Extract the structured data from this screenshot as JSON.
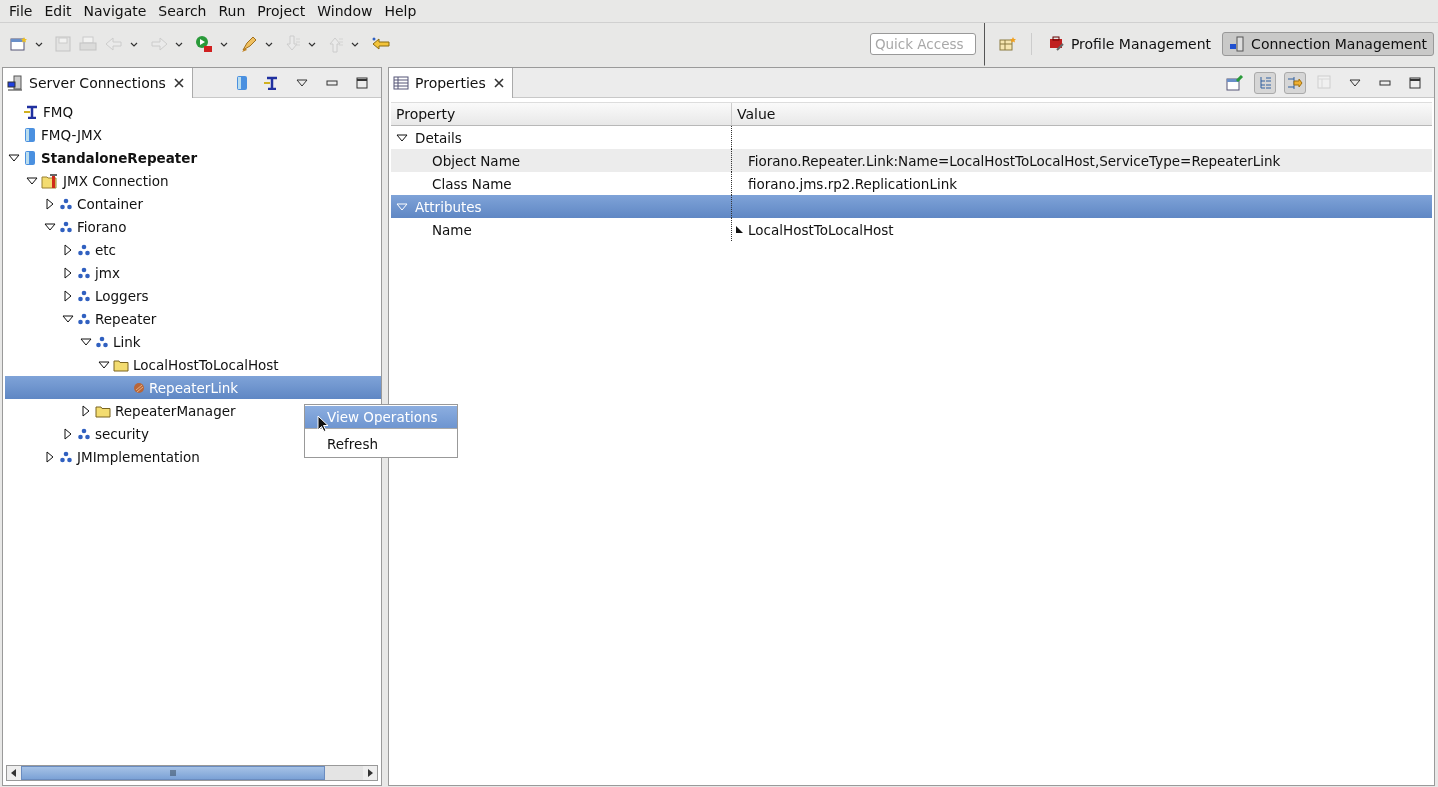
{
  "menu_bar": [
    "File",
    "Edit",
    "Navigate",
    "Search",
    "Run",
    "Project",
    "Window",
    "Help"
  ],
  "toolbar": [
    {
      "kind": "new-window",
      "disabled": false,
      "dropdown": true
    },
    {
      "kind": "save",
      "disabled": true,
      "dropdown": false
    },
    {
      "kind": "print",
      "disabled": true,
      "dropdown": false
    },
    {
      "kind": "back",
      "disabled": true,
      "dropdown": true
    },
    {
      "kind": "forward",
      "disabled": true,
      "dropdown": true
    },
    {
      "kind": "run",
      "disabled": false,
      "dropdown": true
    },
    {
      "kind": "brush",
      "disabled": false,
      "dropdown": true
    },
    {
      "kind": "down",
      "disabled": true,
      "dropdown": true
    },
    {
      "kind": "up",
      "disabled": true,
      "dropdown": true
    },
    {
      "kind": "pin",
      "disabled": false,
      "dropdown": false
    }
  ],
  "quick_access": {
    "placeholder": "Quick Access"
  },
  "perspectives": [
    {
      "label": "Profile Management",
      "selected": false
    },
    {
      "label": "Connection Management",
      "selected": true
    }
  ],
  "server_connections": {
    "tab": "Server Connections",
    "tree": [
      {
        "label": "FMQ",
        "kind": "jms",
        "connected": false
      },
      {
        "label": "FMQ-JMX",
        "kind": "server",
        "connected": false
      },
      {
        "label": "StandaloneRepeater",
        "kind": "server",
        "connected": true,
        "expanded": true,
        "children": [
          {
            "label": "JMX Connection",
            "kind": "jmx",
            "expanded": true,
            "children": [
              {
                "label": "Container",
                "kind": "domain",
                "expanded": false
              },
              {
                "label": "Fiorano",
                "kind": "domain",
                "expanded": true,
                "children": [
                  {
                    "label": "etc",
                    "kind": "domain",
                    "expanded": false
                  },
                  {
                    "label": "jmx",
                    "kind": "domain",
                    "expanded": false
                  },
                  {
                    "label": "Loggers",
                    "kind": "domain",
                    "expanded": false
                  },
                  {
                    "label": "Repeater",
                    "kind": "domain",
                    "expanded": true,
                    "children": [
                      {
                        "label": "Link",
                        "kind": "domain",
                        "expanded": true,
                        "children": [
                          {
                            "label": "LocalHostToLocalHost",
                            "kind": "folder",
                            "expanded": true,
                            "children": [
                              {
                                "label": "RepeaterLink",
                                "kind": "bean",
                                "selected": true
                              }
                            ]
                          }
                        ]
                      },
                      {
                        "label": "RepeaterManager",
                        "kind": "folder",
                        "expanded": false
                      }
                    ]
                  },
                  {
                    "label": "security",
                    "kind": "domain",
                    "expanded": false
                  }
                ]
              },
              {
                "label": "JMImplementation",
                "kind": "domain",
                "expanded": false
              }
            ]
          }
        ]
      }
    ]
  },
  "context_menu": [
    {
      "label": "View Operations",
      "selected": true
    },
    {
      "label": "Refresh",
      "selected": false
    }
  ],
  "properties": {
    "tab": "Properties",
    "columns": [
      "Property",
      "Value"
    ],
    "categories": [
      {
        "label": "Details",
        "expanded": true,
        "selected": false,
        "rows": [
          {
            "property": "Object Name",
            "value": "Fiorano.Repeater.Link:Name=LocalHostToLocalHost,ServiceType=RepeaterLink",
            "hovered": true,
            "editable": false
          },
          {
            "property": "Class Name",
            "value": "fiorano.jms.rp2.ReplicationLink",
            "hovered": false,
            "editable": false
          }
        ]
      },
      {
        "label": "Attributes",
        "expanded": true,
        "selected": true,
        "rows": [
          {
            "property": "Name",
            "value": "LocalHostToLocalHost",
            "hovered": false,
            "editable": true
          }
        ]
      }
    ]
  }
}
